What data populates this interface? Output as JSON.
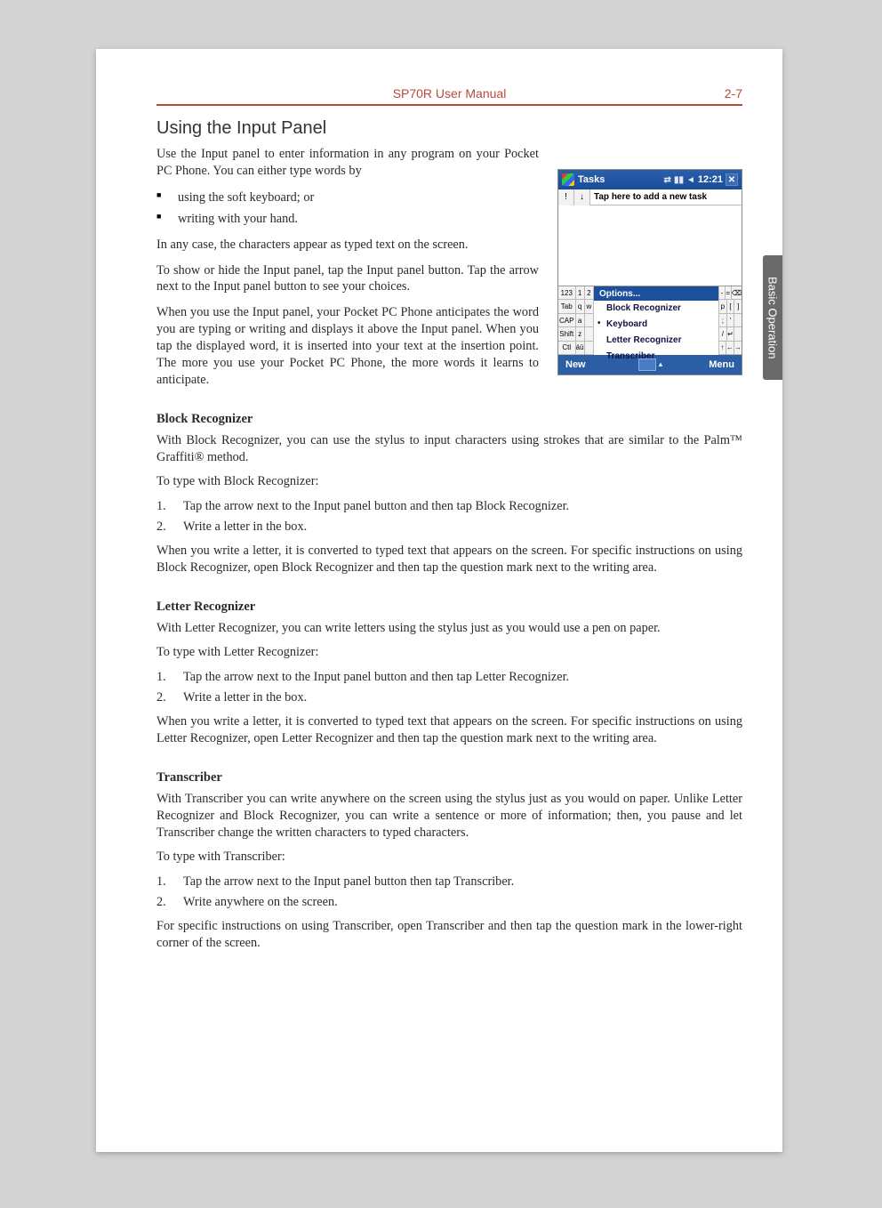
{
  "header": {
    "left": "",
    "center": "SP70R User Manual",
    "right": "2-7"
  },
  "side_tab": "Basic Operation",
  "section_title": "Using the Input Panel",
  "intro": {
    "p1": "Use the Input panel to enter information in any program on your Pocket PC Phone. You can either type  words by",
    "bullets": [
      "using the soft keyboard; or",
      "writing with your hand."
    ],
    "p2": "In any case, the characters appear as typed text on the screen.",
    "p3": "To show or hide the Input panel, tap the Input panel button. Tap the arrow next to the Input panel button to see your choices.",
    "p4": "When you use the Input panel, your Pocket PC Phone anticipates the word you are typing or writing and displays it above the Input panel. When you tap the displayed word, it is inserted into your text at the insertion point. The more you use your Pocket PC Phone, the more words it learns to anticipate."
  },
  "screenshot": {
    "title": "Tasks",
    "time": "12:21",
    "task_row": {
      "btn1": "!",
      "btn2": "↓",
      "text": "Tap here to add a new task"
    },
    "options_label": "Options...",
    "popup_items": [
      "Block Recognizer",
      "Keyboard",
      "Letter Recognizer",
      "Transcriber"
    ],
    "selected_index": 1,
    "left_keys": [
      [
        "123",
        "1",
        "2"
      ],
      [
        "Tab",
        "q",
        "w"
      ],
      [
        "CAP",
        "a",
        ""
      ],
      [
        "Shift",
        "z",
        ""
      ],
      [
        "Ctl",
        "áü",
        ""
      ]
    ],
    "right_keys": [
      [
        "-",
        "=",
        "⌫"
      ],
      [
        "p",
        "[",
        "]"
      ],
      [
        ";",
        "'",
        ""
      ],
      [
        "/",
        "↵",
        ""
      ],
      [
        "↑",
        "←",
        "→"
      ]
    ],
    "bottom": {
      "left": "New",
      "right": "Menu"
    }
  },
  "block": {
    "title": "Block Recognizer",
    "p1": "With Block Recognizer, you can use the stylus to input characters using strokes that are similar to the Palm™ Graffiti® method.",
    "p2": "To type with Block Recognizer:",
    "steps": [
      "Tap the arrow next to the Input panel button and then tap Block Recognizer.",
      "Write a letter in the box."
    ],
    "p3": "When you write a letter, it is converted to typed text that appears on the screen. For specific instructions on using Block Recognizer, open Block Recognizer and then tap the question mark next to the writing area."
  },
  "letter": {
    "title": "Letter Recognizer",
    "p1": "With Letter Recognizer, you can write letters using the stylus just as you would use a pen on paper.",
    "p2": "To type with Letter Recognizer:",
    "steps": [
      "Tap the arrow next to the Input panel button and then tap Letter Recognizer.",
      "Write a letter in the box."
    ],
    "p3": "When you write a letter, it is converted to typed text that appears on the screen. For specific instructions on using Letter Recognizer, open Letter Recognizer and then tap the question mark next to the writing area."
  },
  "trans": {
    "title": "Transcriber",
    "p1": "With Transcriber you can write anywhere on the screen using the stylus just as you would on paper. Unlike Letter Recognizer and Block Recognizer, you can write a sentence or more of information; then, you pause and let Transcriber change the written characters to typed characters.",
    "p2": "To type with Transcriber:",
    "steps": [
      "Tap the arrow next to the Input panel button then tap Transcriber.",
      "Write anywhere on the screen."
    ],
    "p3": "For specific instructions on using Transcriber, open Transcriber and then tap the question mark in the lower-right corner of the screen."
  }
}
